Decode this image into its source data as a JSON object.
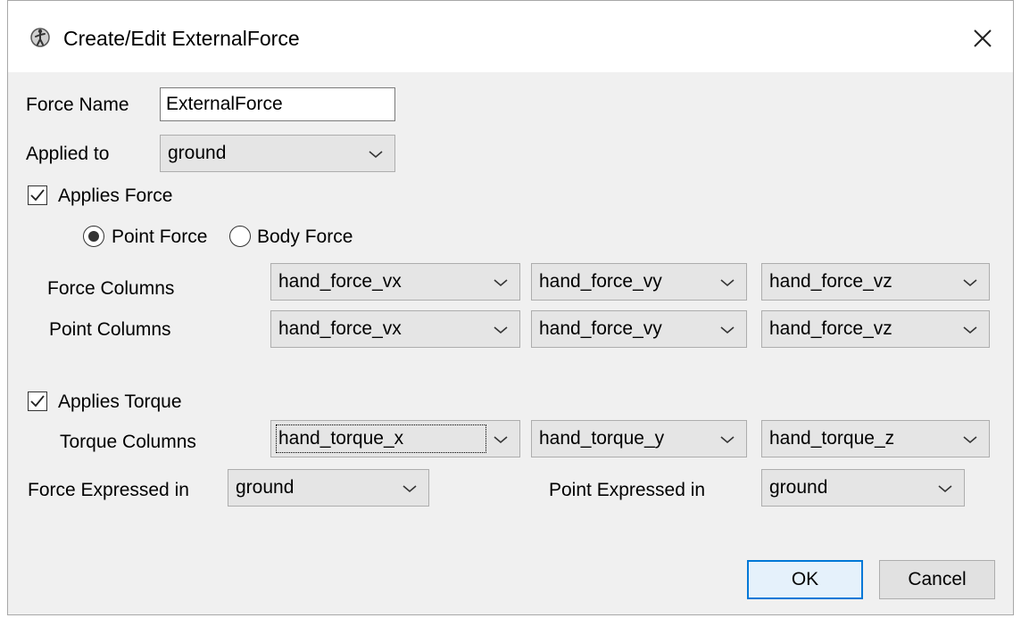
{
  "window": {
    "title": "Create/Edit ExternalForce",
    "close_glyph": "✕"
  },
  "force_name": {
    "label": "Force Name",
    "value": "ExternalForce"
  },
  "applied_to": {
    "label": "Applied to",
    "value": "ground"
  },
  "applies_force": {
    "label": "Applies Force",
    "checked": true
  },
  "force_type": {
    "point_label": "Point Force",
    "body_label": "Body Force",
    "selected": "Point Force"
  },
  "force_columns": {
    "label": "Force Columns",
    "values": [
      "hand_force_vx",
      "hand_force_vy",
      "hand_force_vz"
    ]
  },
  "point_columns": {
    "label": "Point Columns",
    "values": [
      "hand_force_vx",
      "hand_force_vy",
      "hand_force_vz"
    ]
  },
  "applies_torque": {
    "label": "Applies Torque",
    "checked": true
  },
  "torque_columns": {
    "label": "Torque Columns",
    "values": [
      "hand_torque_x",
      "hand_torque_y",
      "hand_torque_z"
    ]
  },
  "force_expressed": {
    "label": "Force Expressed in",
    "value": "ground"
  },
  "point_expressed": {
    "label": "Point Expressed in",
    "value": "ground"
  },
  "buttons": {
    "ok": "OK",
    "cancel": "Cancel"
  },
  "icons": {
    "title": "app-figure-icon",
    "close": "close-icon",
    "chevron": "chevron-down-icon",
    "check": "checkmark-icon"
  }
}
